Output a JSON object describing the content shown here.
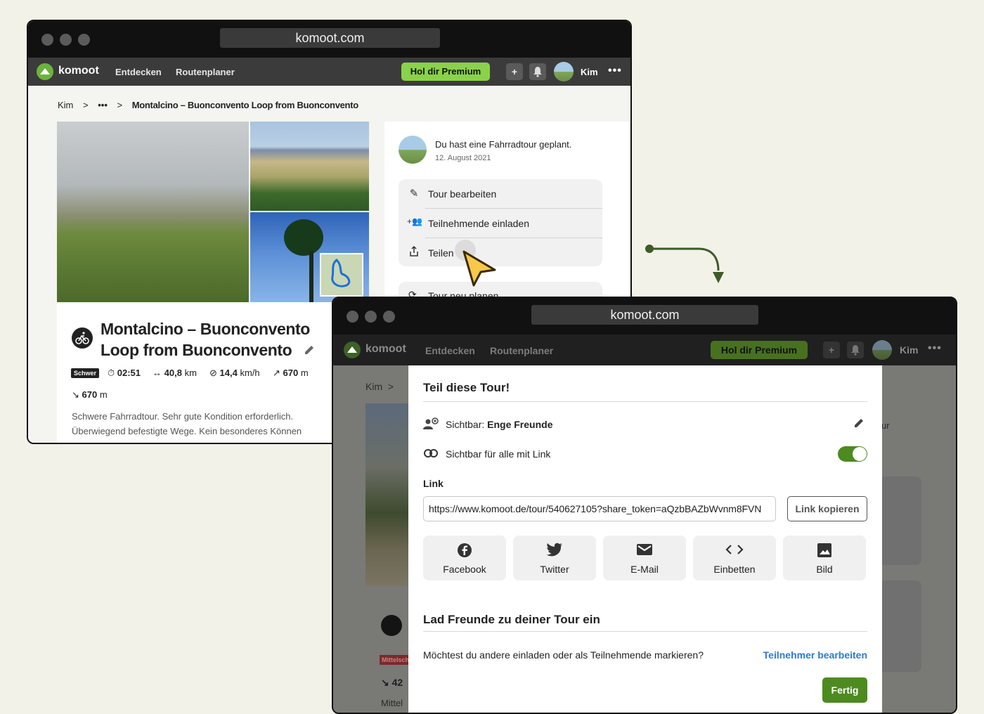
{
  "colors": {
    "page_bg": "#f3f2e8",
    "brand_green": "#6cb33e",
    "premium_green": "#8ad24a",
    "link_blue": "#2a7bd3",
    "done_green": "#4d8a20",
    "arrow_green": "#3e5b28",
    "cursor_yellow": "#f7c84a"
  },
  "win1": {
    "url": "komoot.com",
    "nav": {
      "logo": "komoot",
      "links": [
        "Entdecken",
        "Routenplaner"
      ],
      "premium": "Hol dir Premium",
      "user": "Kim",
      "more": "•••",
      "icons": [
        "plus-square-icon",
        "bell-icon"
      ]
    },
    "breadcrumb": {
      "items": [
        "Kim",
        "•••",
        "Montalcino – Buonconvento Loop from Buonconvento"
      ]
    },
    "activity": {
      "text": "Du hast eine Fahrradtour geplant.",
      "date": "12. August 2021"
    },
    "menu": [
      "Tour bearbeiten",
      "Teilnehmende einladen",
      "Teilen"
    ],
    "menu_partial": "Tour neu planen",
    "tour": {
      "title": "Montalcino – Buonconvento Loop from Buonconvento",
      "difficulty": "Schwer",
      "duration": "02:51",
      "distance": "40,8",
      "distance_unit": "km",
      "speed": "14,4",
      "speed_unit": "km/h",
      "up": "670",
      "up_unit": "m",
      "down": "670",
      "down_unit": "m",
      "description_line1": "Schwere Fahrradtour. Sehr gute Kondition erforderlich.",
      "description_line2": "Überwiegend befestigte Wege. Kein besonderes Können"
    }
  },
  "win2": {
    "url": "komoot.com",
    "nav": {
      "logo": "komoot",
      "links": [
        "Entdecken",
        "Routenplaner"
      ],
      "premium": "Hol dir Premium",
      "user": "Kim",
      "more": "•••"
    },
    "bg": {
      "breadcrumb_start": "Kim",
      "badge": "Mittelsch",
      "stat_prefix": "42",
      "text_prefix": "Mittel",
      "partial_ur": "ur"
    },
    "dialog": {
      "title": "Teil diese Tour!",
      "visibility_label": "Sichtbar:",
      "visibility_value": "Enge Freunde",
      "link_toggle_label": "Sichtbar für alle mit Link",
      "link_toggle_on": true,
      "link_heading": "Link",
      "link_url": "https://www.komoot.de/tour/540627105?share_token=aQzbBAZbWvnm8FVN",
      "copy_button": "Link kopieren",
      "share_buttons": [
        {
          "label": "Facebook",
          "icon": "facebook-icon"
        },
        {
          "label": "Twitter",
          "icon": "twitter-icon"
        },
        {
          "label": "E-Mail",
          "icon": "mail-icon"
        },
        {
          "label": "Einbetten",
          "icon": "embed-icon"
        },
        {
          "label": "Bild",
          "icon": "image-icon"
        }
      ],
      "invite_title": "Lad Freunde zu deiner Tour ein",
      "invite_question": "Möchtest du andere einladen oder als Teilnehmende markieren?",
      "invite_link": "Teilnehmer bearbeiten",
      "done_button": "Fertig"
    }
  }
}
